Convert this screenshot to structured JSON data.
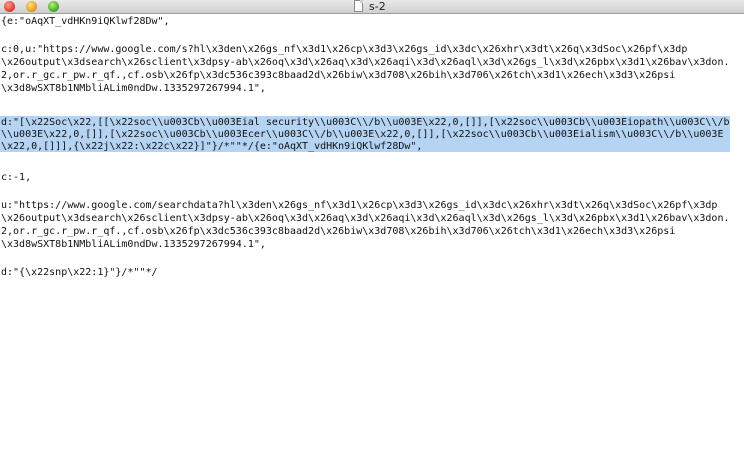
{
  "window": {
    "title": "s-2",
    "close_label": "close",
    "minimize_label": "minimize",
    "zoom_label": "zoom"
  },
  "lines": [
    "{e:\"oAqXT_vdHKn9iQKlwf28Dw\",",
    "",
    "c:0,u:\"https://www.google.com/s?hl\\x3den\\x26gs_nf\\x3d1\\x26cp\\x3d3\\x26gs_id\\x3dc\\x26xhr\\x3dt\\x26q\\x3dSoc\\x26pf\\x3dp",
    "\\x26output\\x3dsearch\\x26sclient\\x3dpsy-ab\\x26oq\\x3d\\x26aq\\x3d\\x26aqi\\x3d\\x26aql\\x3d\\x26gs_l\\x3d\\x26pbx\\x3d1\\x26bav\\x3don.",
    "2,or.r_gc.r_pw.r_qf.,cf.osb\\x26fp\\x3dc536c393c8baad2d\\x26biw\\x3d708\\x26bih\\x3d706\\x26tch\\x3d1\\x26ech\\x3d3\\x26psi",
    "\\x3d8wSXT8b1NMbliALim0ndDw.1335297267994.1\",",
    "",
    "d:\"[\\x22Soc\\x22,[[\\x22soc\\\\u003Cb\\\\u003Eial security\\\\u003C\\\\/b\\\\u003E\\x22,0,[]],[\\x22soc\\\\u003Cb\\\\u003Eiopath\\\\u003C\\\\/b",
    "\\\\u003E\\x22,0,[]],[\\x22soc\\\\u003Cb\\\\u003Ecer\\\\u003C\\\\/b\\\\u003E\\x22,0,[]],[\\x22soc\\\\u003Cb\\\\u003Eialism\\\\u003C\\\\/b\\\\u003E",
    "\\x22,0,[]]],{\\x22j\\x22:\\x22c\\x22}]\"}/*\"\"*/{e:\"oAqXT_vdHKn9iQKlwf28Dw\",",
    "",
    "c:-1,",
    "",
    "u:\"https://www.google.com/searchdata?hl\\x3den\\x26gs_nf\\x3d1\\x26cp\\x3d3\\x26gs_id\\x3dc\\x26xhr\\x3dt\\x26q\\x3dSoc\\x26pf\\x3dp",
    "\\x26output\\x3dsearch\\x26sclient\\x3dpsy-ab\\x26oq\\x3d\\x26aq\\x3d\\x26aqi\\x3d\\x26aql\\x3d\\x26gs_l\\x3d\\x26pbx\\x3d1\\x26bav\\x3don.",
    "2,or.r_gc.r_pw.r_qf.,cf.osb\\x26fp\\x3dc536c393c8baad2d\\x26biw\\x3d708\\x26bih\\x3d706\\x26tch\\x3d1\\x26ech\\x3d3\\x26psi",
    "\\x3d8wSXT8b1NMbliALim0ndDw.1335297267994.1\",",
    "",
    "d:\"{\\x22snp\\x22:1}\"}/*\"\"*/"
  ]
}
